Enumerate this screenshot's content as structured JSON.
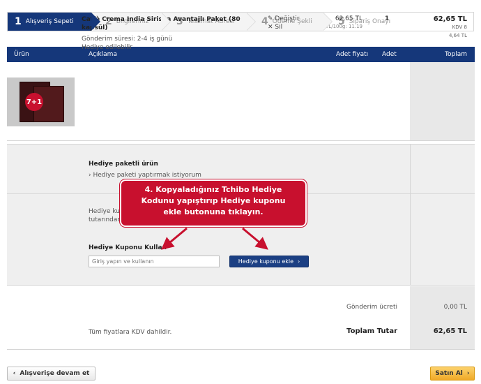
{
  "steps": [
    {
      "num": "1",
      "label": "Alışveriş Sepeti"
    },
    {
      "num": "2",
      "label": "Bilgileriniz"
    },
    {
      "num": "3",
      "label": "Teslimat Adresi"
    },
    {
      "num": "4",
      "label": "Ödeme Şekli"
    },
    {
      "num": "5",
      "label": "Sipariş Onayı"
    }
  ],
  "table": {
    "headers": {
      "product": "Ürün",
      "description": "Açıklama",
      "unit_price": "Adet fiyatı",
      "qty": "Adet",
      "total": "Toplam"
    }
  },
  "product": {
    "badge": "7+1",
    "title": "Caffè Crema India Sirisha Avantajlı Paket (80 kapsül)",
    "shipping_time": "Gönderim süresi: 2-4 iş günü",
    "giftable": "Hediye edilebilir",
    "edit_label": "Değiştir",
    "delete_label": "Sil",
    "price": "62,65 TL",
    "unit_price": "TL/100g: 11.19",
    "qty": "1",
    "total": "62,65 TL",
    "kdv_rate": "KDV 8",
    "kdv_amount": "4,64 TL"
  },
  "gift": {
    "wrap_heading": "Hediye paketli ürün",
    "wrap_link": "› Hediye paketi yaptırmak istiyorum",
    "desc_line1": "Hediye ku",
    "desc_line2": "tutarından",
    "coupon_heading": "Hediye Kuponu Kullan",
    "coupon_placeholder": "Giriş yapın ve kullanın",
    "coupon_button": "Hediye kuponu ekle"
  },
  "callout": {
    "line1": "4. Kopyaladığınız Tchibo Hediye",
    "line2": "Kodunu yapıştırıp Hediye kuponu",
    "line3": "ekle butonuna tıklayın."
  },
  "summary": {
    "shipping_label": "Gönderim ücreti",
    "shipping_value": "0,00 TL",
    "kdv_note": "Tüm fiyatlara KDV dahildir.",
    "total_label": "Toplam Tutar",
    "total_value": "62,65 TL"
  },
  "footer": {
    "back_label": "Alışverişe devam et",
    "buy_label": "Satın Al"
  },
  "colors": {
    "primary": "#15377a",
    "callout": "#c8102e",
    "buy": "#f0a927"
  }
}
